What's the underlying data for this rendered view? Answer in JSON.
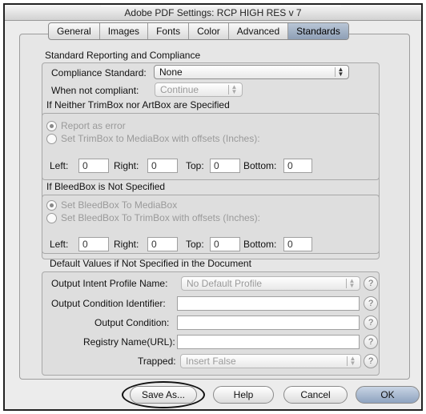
{
  "window": {
    "title": "Adobe PDF Settings: RCP HIGH RES v 7"
  },
  "tabs": [
    {
      "label": "General"
    },
    {
      "label": "Images"
    },
    {
      "label": "Fonts"
    },
    {
      "label": "Color"
    },
    {
      "label": "Advanced"
    },
    {
      "label": "Standards",
      "active": true
    }
  ],
  "standards": {
    "section_title": "Standard Reporting and Compliance",
    "compliance_label": "Compliance Standard:",
    "compliance_value": "None",
    "when_label": "When not compliant:",
    "when_value": "Continue"
  },
  "trimbox": {
    "title": "If Neither TrimBox nor ArtBox are Specified",
    "option1": "Report as error",
    "option2": "Set TrimBox to MediaBox with offsets (Inches):",
    "left_label": "Left:",
    "left_value": "0",
    "right_label": "Right:",
    "right_value": "0",
    "top_label": "Top:",
    "top_value": "0",
    "bottom_label": "Bottom:",
    "bottom_value": "0"
  },
  "bleedbox": {
    "title": "If BleedBox is Not Specified",
    "option1": "Set BleedBox To MediaBox",
    "option2": "Set BleedBox To TrimBox with offsets (Inches):",
    "left_label": "Left:",
    "left_value": "0",
    "right_label": "Right:",
    "right_value": "0",
    "top_label": "Top:",
    "top_value": "0",
    "bottom_label": "Bottom:",
    "bottom_value": "0"
  },
  "defaults": {
    "title": "Default Values if Not Specified in the Document",
    "output_intent_label": "Output Intent Profile Name:",
    "output_intent_value": "No Default Profile",
    "output_condition_id_label": "Output Condition Identifier:",
    "output_condition_label": "Output Condition:",
    "registry_label": "Registry Name(URL):",
    "trapped_label": "Trapped:",
    "trapped_value": "Insert False",
    "help_glyph": "?"
  },
  "buttons": {
    "save_as": "Save As...",
    "help": "Help",
    "cancel": "Cancel",
    "ok": "OK"
  }
}
